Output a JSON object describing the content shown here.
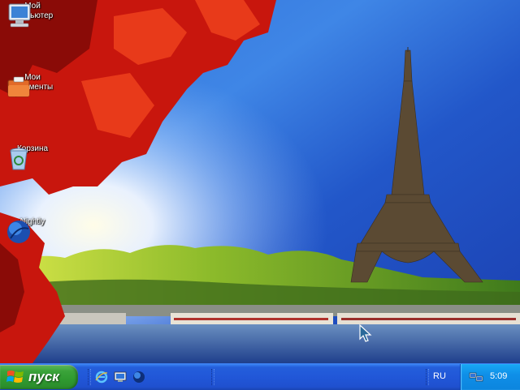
{
  "desktop": {
    "icons": [
      {
        "label": "Мой\nкомпьютер",
        "icon": "my-computer-icon"
      },
      {
        "label": "Мои\nдокументы",
        "icon": "my-documents-icon"
      },
      {
        "label": "Корзина",
        "icon": "recycle-bin-icon"
      },
      {
        "label": "Nightly",
        "icon": "nightly-browser-icon"
      }
    ],
    "wallpaper": "eiffel-tower-autumn-leaves"
  },
  "taskbar": {
    "start_label": "пуск",
    "quick_launch": [
      "internet-explorer-icon",
      "show-desktop-icon",
      "nightly-browser-icon"
    ],
    "language": "RU",
    "clock": "5:09"
  },
  "colors": {
    "taskbar_blue": "#245edb",
    "start_green": "#3ba33a",
    "tray_blue": "#0f8fe8"
  }
}
